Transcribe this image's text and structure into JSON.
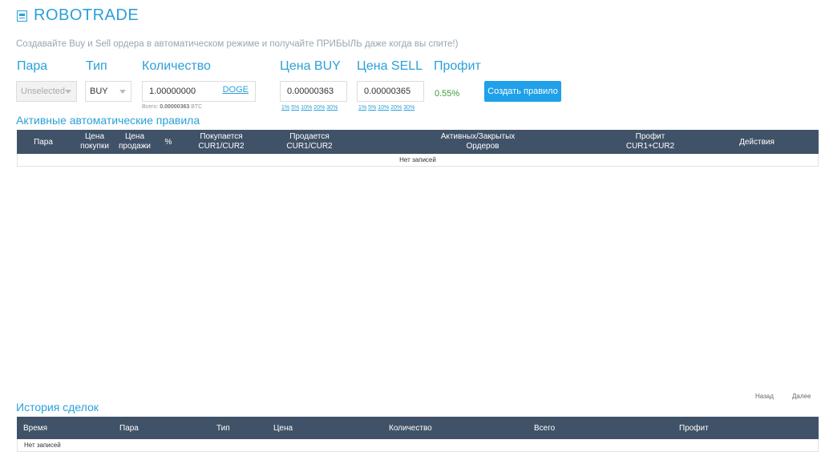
{
  "app": {
    "title": "ROBOTRADE",
    "subtitle": "Создавайте Buy и Sell ордера в автоматическом режиме и получайте ПРИБЫЛЬ даже когда вы спите!)"
  },
  "form": {
    "labels": {
      "pair": "Пара",
      "type": "Тип",
      "quantity": "Количество",
      "price_buy": "Цена BUY",
      "price_sell": "Цена SELL",
      "profit": "Профит"
    },
    "pair_value": "Unselected",
    "type_value": "BUY",
    "quantity_value": "1.00000000",
    "quantity_unit": "DOGE",
    "total_prefix": "Всего:",
    "total_value": "0.00000363",
    "total_unit": "BTC",
    "price_buy_value": "0.00000363",
    "price_sell_value": "0.00000365",
    "percent_links": [
      "1%",
      "5%",
      "10%",
      "20%",
      "30%"
    ],
    "profit_value": "0.55%",
    "create_button": "Создать правило"
  },
  "rules_table": {
    "title": "Активные автоматические правила",
    "headers": [
      {
        "l1": "Пара",
        "l2": ""
      },
      {
        "l1": "Цена",
        "l2": "покупки"
      },
      {
        "l1": "Цена",
        "l2": "продажи"
      },
      {
        "l1": "%",
        "l2": ""
      },
      {
        "l1": "Покупается",
        "l2": "CUR1/CUR2"
      },
      {
        "l1": "Продается",
        "l2": "CUR1/CUR2"
      },
      {
        "l1": "Активных/Закрытых",
        "l2": "Ордеров"
      },
      {
        "l1": "Профит",
        "l2": "CUR1+CUR2"
      },
      {
        "l1": "Действия",
        "l2": ""
      }
    ],
    "empty_text": "Нет записей"
  },
  "pagination": {
    "prev": "Назад",
    "next": "Далее"
  },
  "history_table": {
    "title": "История сделок",
    "headers": [
      "Время",
      "Пара",
      "Тип",
      "Цена",
      "Количество",
      "Всего",
      "Профит"
    ],
    "empty_text": "Нет записей"
  },
  "colors": {
    "accent": "#2ba0d8",
    "header_bg": "#405268",
    "button": "#1fa0e8",
    "profit": "#3c9a3c"
  }
}
